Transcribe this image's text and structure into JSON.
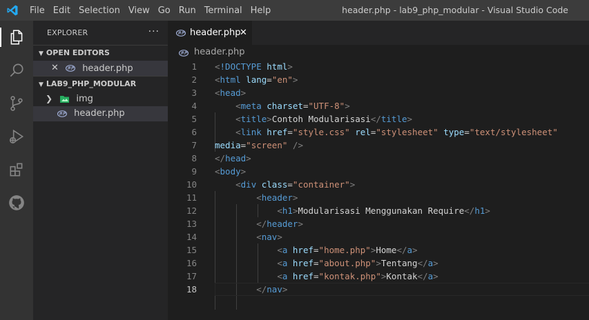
{
  "window": {
    "title": "header.php - lab9_php_modular - Visual Studio Code"
  },
  "menu": [
    "File",
    "Edit",
    "Selection",
    "View",
    "Go",
    "Run",
    "Terminal",
    "Help"
  ],
  "activity_bar": [
    "files-icon",
    "search-icon",
    "source-control-icon",
    "run-debug-icon",
    "extensions-icon",
    "github-icon"
  ],
  "sidebar": {
    "header": "EXPLORER",
    "more": "···",
    "open_editors": {
      "label": "OPEN EDITORS",
      "items": [
        {
          "name": "header.php"
        }
      ]
    },
    "folder": {
      "label": "LAB9_PHP_MODULAR",
      "items": [
        {
          "name": "img",
          "type": "folder"
        },
        {
          "name": "header.php",
          "type": "file"
        }
      ]
    }
  },
  "tab": {
    "label": "header.php",
    "close": "✕"
  },
  "breadcrumb": "header.php",
  "colors": {
    "tag": "#569cd6",
    "attr": "#9cdcfe",
    "string": "#ce9178",
    "punct": "#808080",
    "text": "#d4d4d4"
  },
  "editor": {
    "current_line": 18,
    "lines": [
      {
        "n": "1",
        "tokens": [
          [
            "d",
            "<"
          ],
          [
            "g",
            "!DOCTYPE"
          ],
          [
            "x",
            " "
          ],
          [
            "a",
            "html"
          ],
          [
            "d",
            ">"
          ]
        ]
      },
      {
        "n": "2",
        "tokens": [
          [
            "d",
            "<"
          ],
          [
            "g",
            "html"
          ],
          [
            "x",
            " "
          ],
          [
            "a",
            "lang"
          ],
          [
            "x",
            "="
          ],
          [
            "s",
            "\"en\""
          ],
          [
            "d",
            ">"
          ]
        ]
      },
      {
        "n": "3",
        "tokens": [
          [
            "d",
            "<"
          ],
          [
            "g",
            "head"
          ],
          [
            "d",
            ">"
          ]
        ]
      },
      {
        "n": "4",
        "tokens": [
          [
            "x",
            "    "
          ],
          [
            "d",
            "<"
          ],
          [
            "g",
            "meta"
          ],
          [
            "x",
            " "
          ],
          [
            "a",
            "charset"
          ],
          [
            "x",
            "="
          ],
          [
            "s",
            "\"UTF-8\""
          ],
          [
            "d",
            ">"
          ]
        ]
      },
      {
        "n": "5",
        "tokens": [
          [
            "x",
            "    "
          ],
          [
            "d",
            "<"
          ],
          [
            "g",
            "title"
          ],
          [
            "d",
            ">"
          ],
          [
            "x",
            "Contoh Modularisasi"
          ],
          [
            "d",
            "</"
          ],
          [
            "g",
            "title"
          ],
          [
            "d",
            ">"
          ]
        ]
      },
      {
        "n": "6",
        "tokens": [
          [
            "x",
            "    "
          ],
          [
            "d",
            "<"
          ],
          [
            "g",
            "link"
          ],
          [
            "x",
            " "
          ],
          [
            "a",
            "href"
          ],
          [
            "x",
            "="
          ],
          [
            "s",
            "\"style.css\""
          ],
          [
            "x",
            " "
          ],
          [
            "a",
            "rel"
          ],
          [
            "x",
            "="
          ],
          [
            "s",
            "\"stylesheet\""
          ],
          [
            "x",
            " "
          ],
          [
            "a",
            "type"
          ],
          [
            "x",
            "="
          ],
          [
            "s",
            "\"text/stylesheet\""
          ]
        ]
      },
      {
        "n": "7",
        "tokens": [
          [
            "a",
            "media"
          ],
          [
            "x",
            "="
          ],
          [
            "s",
            "\"screen\""
          ],
          [
            "x",
            " "
          ],
          [
            "d",
            "/>"
          ]
        ]
      },
      {
        "n": "8",
        "tokens": [
          [
            "d",
            "</"
          ],
          [
            "g",
            "head"
          ],
          [
            "d",
            ">"
          ]
        ]
      },
      {
        "n": "9",
        "tokens": [
          [
            "d",
            "<"
          ],
          [
            "g",
            "body"
          ],
          [
            "d",
            ">"
          ]
        ]
      },
      {
        "n": "10",
        "tokens": [
          [
            "x",
            "    "
          ],
          [
            "d",
            "<"
          ],
          [
            "g",
            "div"
          ],
          [
            "x",
            " "
          ],
          [
            "a",
            "class"
          ],
          [
            "x",
            "="
          ],
          [
            "s",
            "\"container\""
          ],
          [
            "d",
            ">"
          ]
        ]
      },
      {
        "n": "11",
        "tokens": [
          [
            "x",
            "        "
          ],
          [
            "d",
            "<"
          ],
          [
            "g",
            "header"
          ],
          [
            "d",
            ">"
          ]
        ]
      },
      {
        "n": "12",
        "tokens": [
          [
            "x",
            "            "
          ],
          [
            "d",
            "<"
          ],
          [
            "g",
            "h1"
          ],
          [
            "d",
            ">"
          ],
          [
            "x",
            "Modularisasi Menggunakan Require"
          ],
          [
            "d",
            "</"
          ],
          [
            "g",
            "h1"
          ],
          [
            "d",
            ">"
          ]
        ]
      },
      {
        "n": "13",
        "tokens": [
          [
            "x",
            "        "
          ],
          [
            "d",
            "</"
          ],
          [
            "g",
            "header"
          ],
          [
            "d",
            ">"
          ]
        ]
      },
      {
        "n": "14",
        "tokens": [
          [
            "x",
            "        "
          ],
          [
            "d",
            "<"
          ],
          [
            "g",
            "nav"
          ],
          [
            "d",
            ">"
          ]
        ]
      },
      {
        "n": "15",
        "tokens": [
          [
            "x",
            "            "
          ],
          [
            "d",
            "<"
          ],
          [
            "g",
            "a"
          ],
          [
            "x",
            " "
          ],
          [
            "a",
            "href"
          ],
          [
            "x",
            "="
          ],
          [
            "s",
            "\"home.php\""
          ],
          [
            "d",
            ">"
          ],
          [
            "x",
            "Home"
          ],
          [
            "d",
            "</"
          ],
          [
            "g",
            "a"
          ],
          [
            "d",
            ">"
          ]
        ]
      },
      {
        "n": "16",
        "tokens": [
          [
            "x",
            "            "
          ],
          [
            "d",
            "<"
          ],
          [
            "g",
            "a"
          ],
          [
            "x",
            " "
          ],
          [
            "a",
            "href"
          ],
          [
            "x",
            "="
          ],
          [
            "s",
            "\"about.php\""
          ],
          [
            "d",
            ">"
          ],
          [
            "x",
            "Tentang"
          ],
          [
            "d",
            "</"
          ],
          [
            "g",
            "a"
          ],
          [
            "d",
            ">"
          ]
        ]
      },
      {
        "n": "17",
        "tokens": [
          [
            "x",
            "            "
          ],
          [
            "d",
            "<"
          ],
          [
            "g",
            "a"
          ],
          [
            "x",
            " "
          ],
          [
            "a",
            "href"
          ],
          [
            "x",
            "="
          ],
          [
            "s",
            "\"kontak.php\""
          ],
          [
            "d",
            ">"
          ],
          [
            "x",
            "Kontak"
          ],
          [
            "d",
            "</"
          ],
          [
            "g",
            "a"
          ],
          [
            "d",
            ">"
          ]
        ]
      },
      {
        "n": "18",
        "tokens": [
          [
            "x",
            "        "
          ],
          [
            "d",
            "</"
          ],
          [
            "g",
            "nav"
          ],
          [
            "d",
            ">"
          ]
        ]
      }
    ]
  }
}
